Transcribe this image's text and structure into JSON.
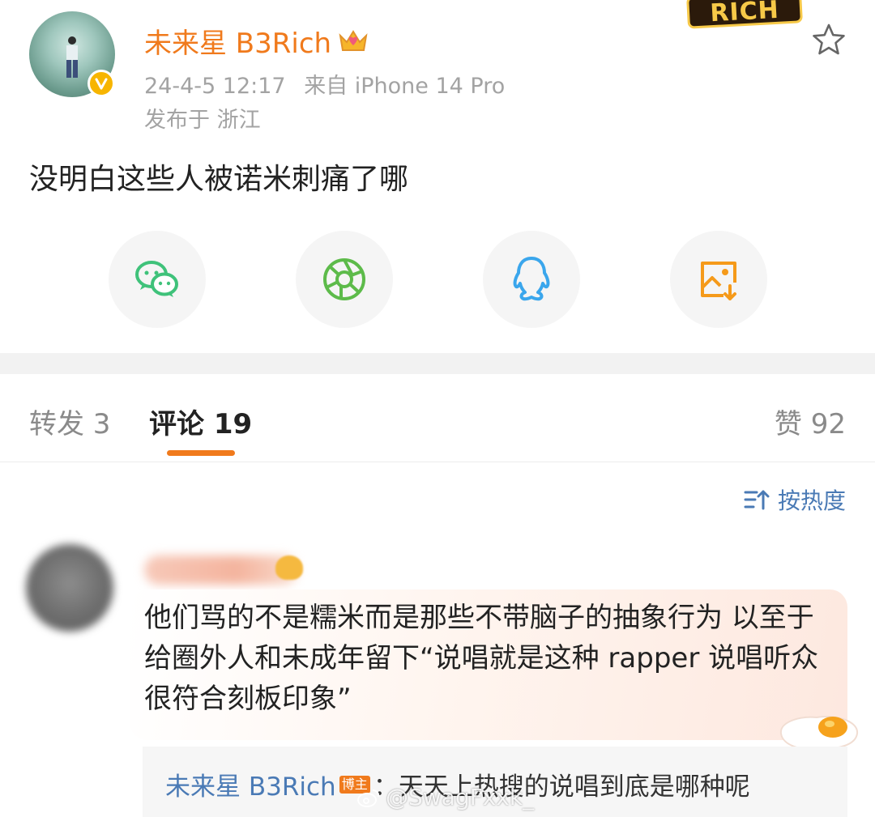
{
  "post": {
    "author_name": "未来星 B3Rich",
    "corner_badge": "RICH",
    "date": "24-4-5 12:17",
    "source": "来自 iPhone 14 Pro",
    "location": "发布于 浙江",
    "text": "没明白这些人被诺米刺痛了哪"
  },
  "share_icons": [
    "wechat-icon",
    "moments-icon",
    "qq-icon",
    "save-image-icon"
  ],
  "tabs": {
    "repost": "转发 3",
    "comments": "评论 19",
    "likes": "赞 92"
  },
  "sort_label": "按热度",
  "comment": {
    "text": "他们骂的不是糯米而是那些不带脑子的抽象行为 以至于给圈外人和未成年留下“说唱就是这种 rapper 说唱听众很符合刻板印象”"
  },
  "reply": {
    "author": "未来星 B3Rich",
    "tag": "博主",
    "text": "：天天上热搜的说唱到底是哪种呢"
  },
  "watermark": "@SwagFxxk_",
  "colors": {
    "accent": "#f07a1c",
    "link": "#4a7ab5",
    "meta": "#a3a3a3",
    "wechat": "#3fc27a",
    "moments": "#5dbb4a",
    "qq": "#3aa6ec",
    "save": "#f59a1a"
  }
}
